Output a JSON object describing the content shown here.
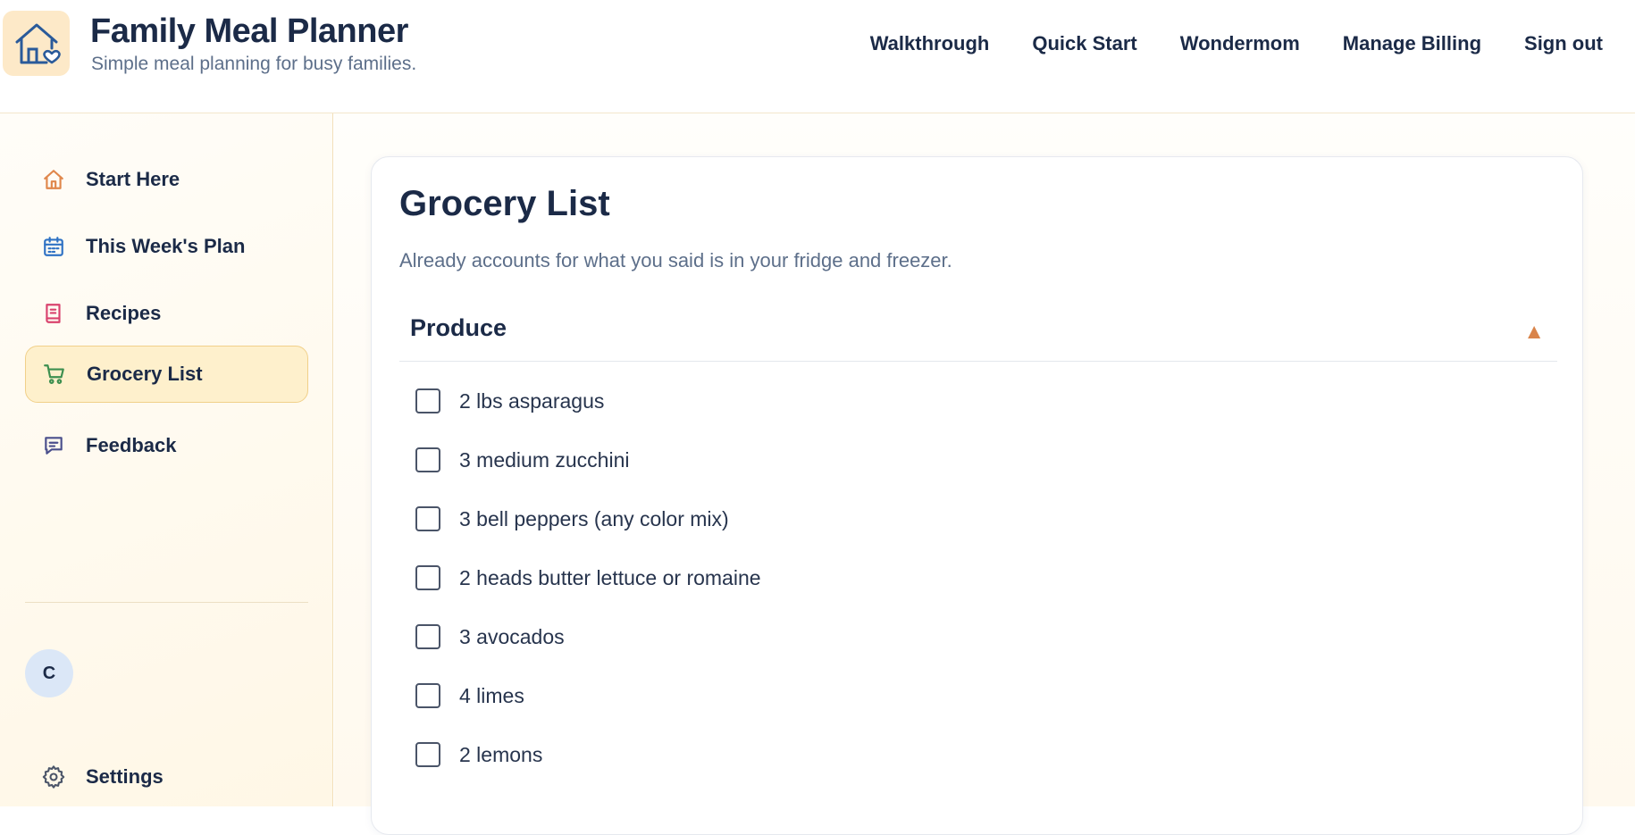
{
  "header": {
    "title": "Family Meal Planner",
    "subtitle": "Simple meal planning for busy families.",
    "logo_icon": "house-heart-icon",
    "nav": [
      {
        "label": "Walkthrough"
      },
      {
        "label": "Quick Start"
      },
      {
        "label": "Wondermom"
      },
      {
        "label": "Manage Billing"
      },
      {
        "label": "Sign out"
      }
    ]
  },
  "sidebar": {
    "items": [
      {
        "label": "Start Here",
        "icon": "home-icon",
        "active": false
      },
      {
        "label": "This Week's Plan",
        "icon": "calendar-icon",
        "active": false
      },
      {
        "label": "Recipes",
        "icon": "book-icon",
        "active": false
      },
      {
        "label": "Grocery List",
        "icon": "cart-icon",
        "active": true
      },
      {
        "label": "Feedback",
        "icon": "chat-icon",
        "active": false
      }
    ],
    "avatar_initial": "C",
    "settings_label": "Settings"
  },
  "main": {
    "title": "Grocery List",
    "description": "Already accounts for what you said is in your fridge and freezer.",
    "sections": [
      {
        "title": "Produce",
        "expanded": true,
        "items": [
          {
            "label": "2 lbs asparagus",
            "checked": false
          },
          {
            "label": "3 medium zucchini",
            "checked": false
          },
          {
            "label": "3 bell peppers (any color mix)",
            "checked": false
          },
          {
            "label": "2 heads butter lettuce or romaine",
            "checked": false
          },
          {
            "label": "3 avocados",
            "checked": false
          },
          {
            "label": "4 limes",
            "checked": false
          },
          {
            "label": "2 lemons",
            "checked": false
          }
        ]
      }
    ]
  },
  "colors": {
    "accent": "#d9844a",
    "active_bg": "#fef0cc",
    "text": "#1b2a47",
    "muted": "#5d6f8a"
  }
}
